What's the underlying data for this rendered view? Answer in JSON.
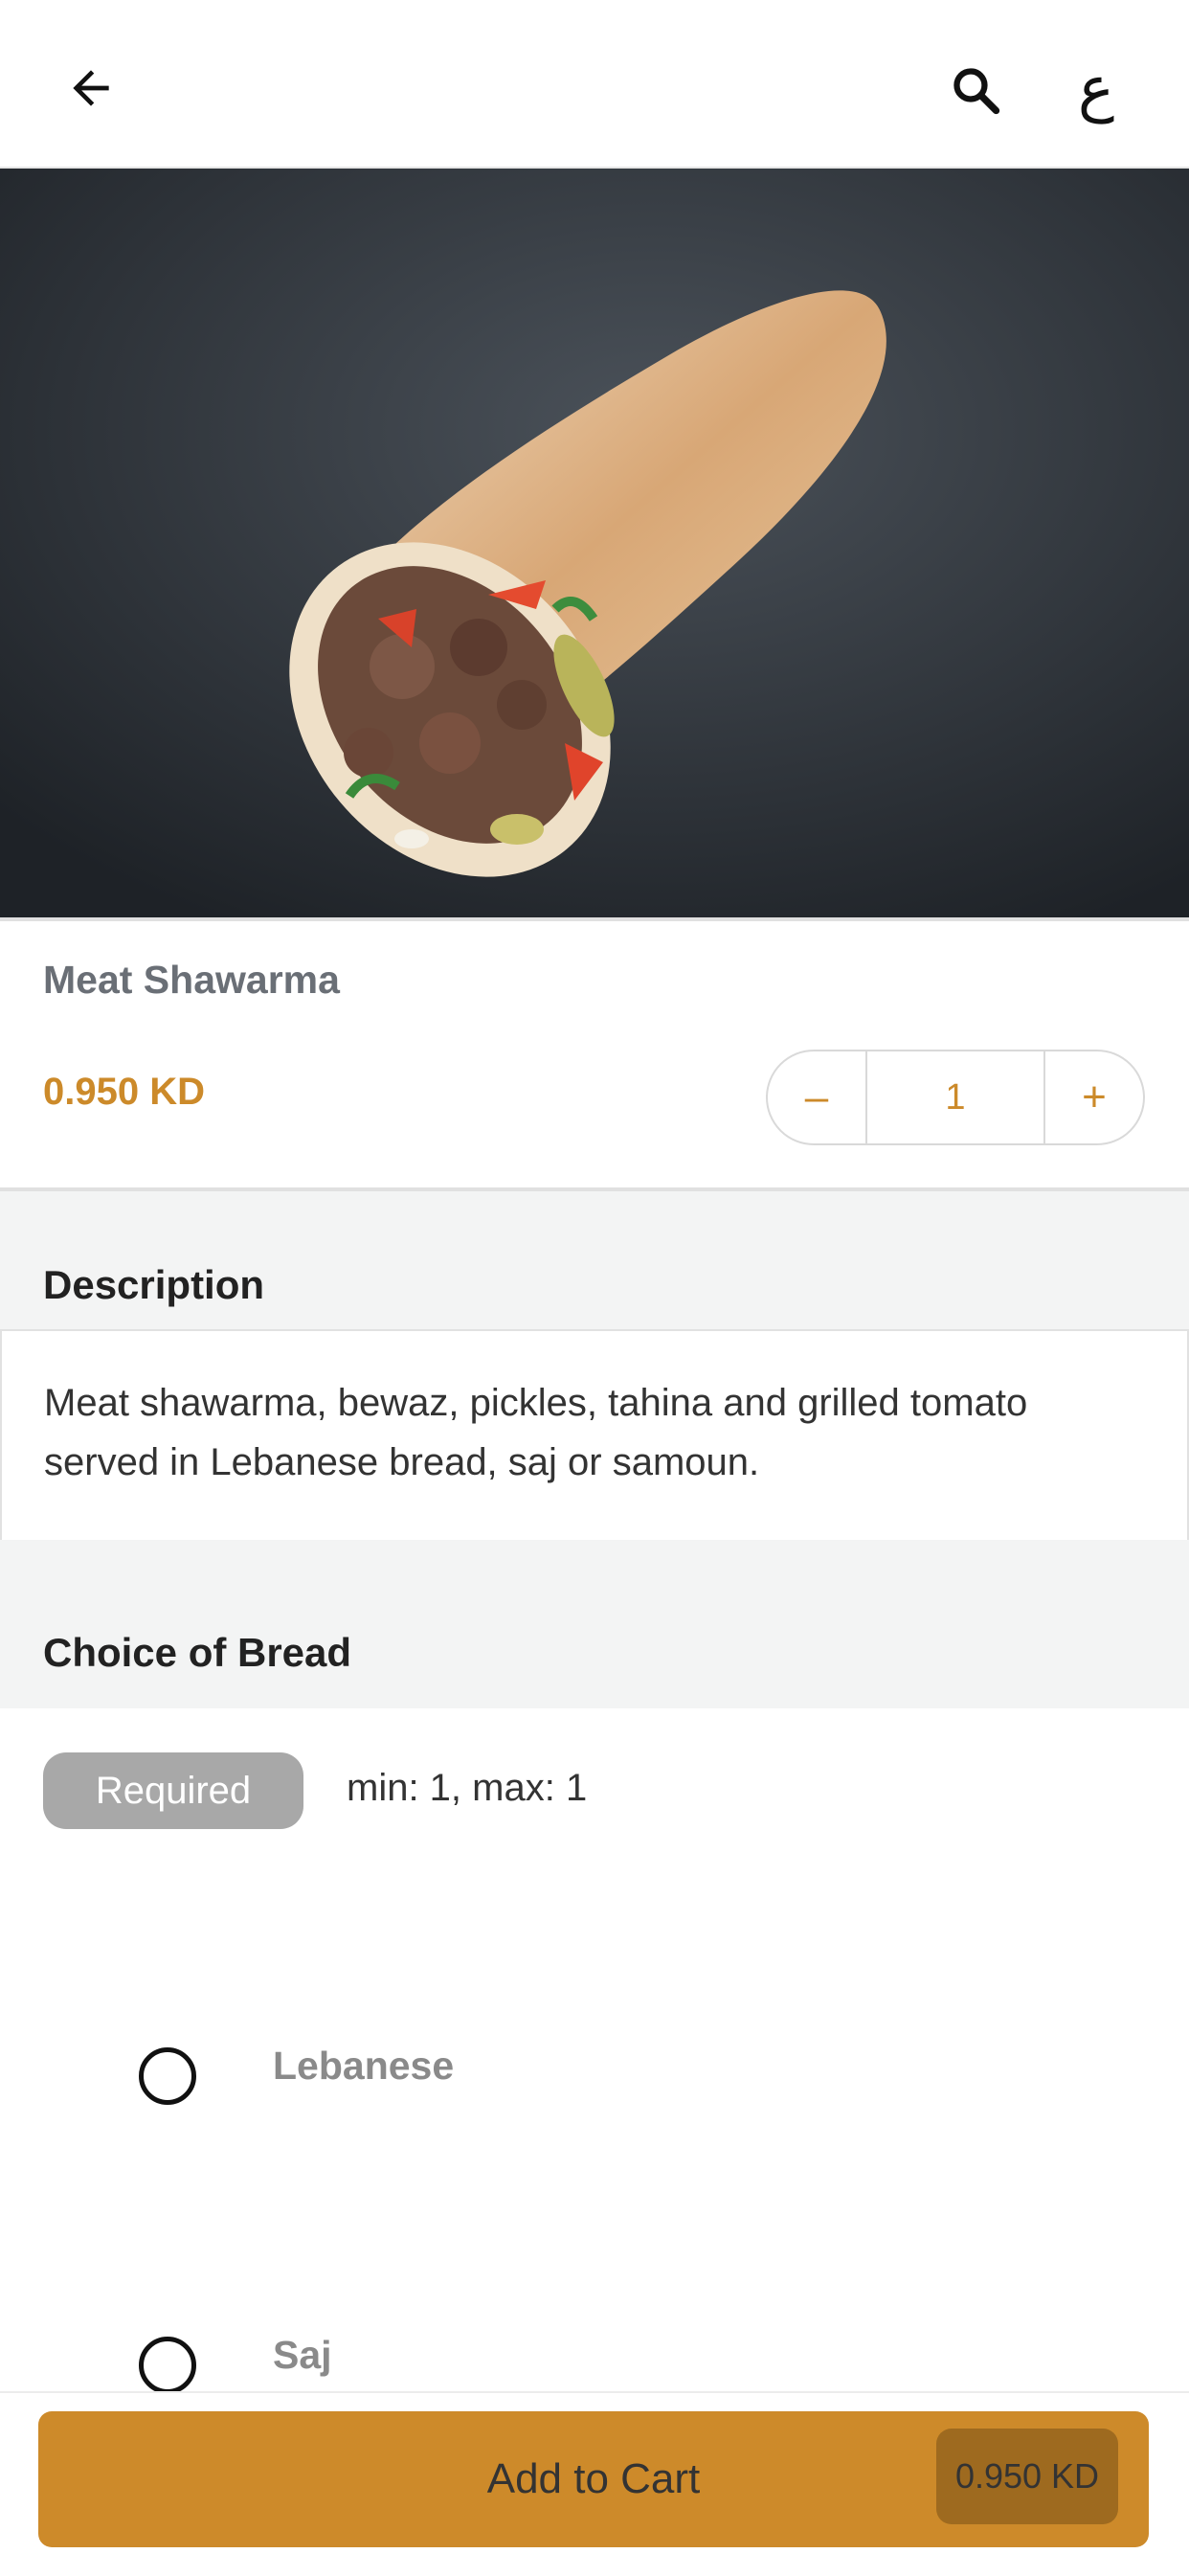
{
  "header": {
    "back_icon": "arrow-left-icon",
    "search_icon": "search-icon",
    "language_toggle": "ع"
  },
  "product": {
    "image_alt": "meat shawarma wrap",
    "title": "Meat Shawarma",
    "price": "0.950 KD",
    "quantity": "1",
    "minus": "–",
    "plus": "+"
  },
  "description": {
    "heading": "Description",
    "text": "Meat shawarma, bewaz, pickles, tahina and grilled tomato served in Lebanese bread, saj or samoun."
  },
  "choice": {
    "heading": "Choice of Bread",
    "badge": "Required",
    "limits": "min: 1, max: 1",
    "options": [
      {
        "label": "Lebanese",
        "selected": false
      },
      {
        "label": "Saj",
        "selected": false
      }
    ]
  },
  "cart": {
    "label": "Add to Cart",
    "price": "0.950 KD"
  },
  "colors": {
    "accent": "#cd8a2a",
    "price_text": "#cc8a2a"
  }
}
